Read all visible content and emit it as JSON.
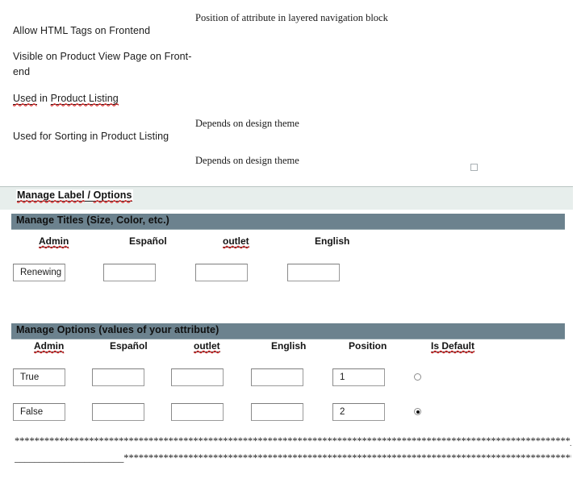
{
  "attribute_properties": {
    "left_labels": [
      "Allow HTML Tags on Frontend",
      "Visible on Product View Page on Front-",
      "end",
      "Used in Product Listing",
      "Used for Sorting in Product Listing"
    ],
    "right_notes": [
      "Position of attribute in layered navigation block",
      "Depends on design theme",
      "Depends on design theme"
    ],
    "used_in_product_listing": {
      "word1": "Used",
      "word_mid": " in ",
      "word2": "Product Listing"
    },
    "checkbox_checked": false
  },
  "band": {
    "label_full": "Manage Label / Options",
    "label_part1": "Manage Label",
    "label_sep": " / ",
    "label_part2": "Options"
  },
  "manage_titles": {
    "section_title": "Manage Titles (Size, Color, etc.)",
    "columns": [
      "Admin",
      "Español",
      "outlet",
      "English"
    ],
    "row": {
      "admin": "Renewing",
      "espanol": "",
      "outlet": "",
      "english": ""
    }
  },
  "manage_options": {
    "section_title": "Manage Options (values of your attribute)",
    "columns": [
      "Admin",
      "Español",
      "outlet",
      "English",
      "Position",
      "Is Default"
    ],
    "rows": [
      {
        "admin": "True",
        "espanol": "",
        "outlet": "",
        "english": "",
        "position": "1",
        "is_default": false
      },
      {
        "admin": "False",
        "espanol": "",
        "outlet": "",
        "english": "",
        "position": "2",
        "is_default": true
      }
    ]
  },
  "separator": {
    "line1": "****************************************************************************************************************_____________",
    "line2": "______________________*********************************************************************************************"
  },
  "colors": {
    "section_bar": "#6c828e",
    "light_band": "#e7eeec",
    "spellcheck_underline": "#e03030"
  }
}
